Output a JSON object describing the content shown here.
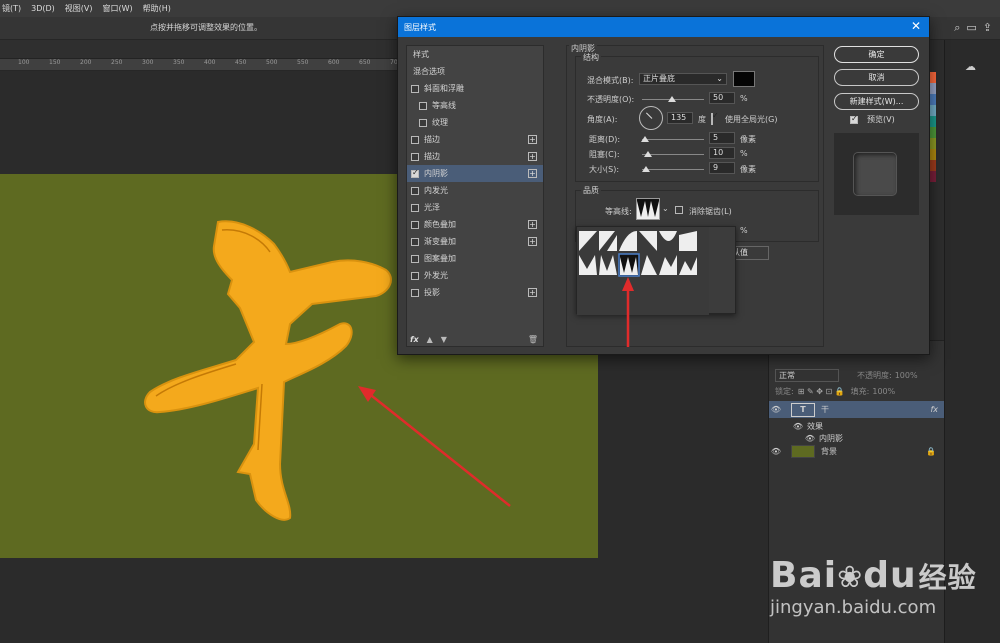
{
  "menubar": {
    "items": [
      "镜(T)",
      "3D(D)",
      "视图(V)",
      "窗口(W)",
      "帮助(H)"
    ]
  },
  "optionsbar": {
    "hint": "点按并拖移可调整效果的位置。"
  },
  "ruler": {
    "ticks": [
      "100",
      "150",
      "200",
      "250",
      "300",
      "350",
      "400",
      "450",
      "500",
      "550",
      "600",
      "650",
      "700"
    ]
  },
  "colors": {
    "canvas_bg": "#5e6a21",
    "glyph_fill": "#f4a91c",
    "glyph_stroke": "#d98a10",
    "accent_blue": "#0a73d9",
    "arrow_red": "#e02b2b"
  },
  "canvas": {
    "glyph": "干"
  },
  "dialog": {
    "title": "图层样式",
    "close_icon": "close-icon",
    "styles": [
      {
        "label": "样式",
        "type": "header"
      },
      {
        "label": "混合选项",
        "type": "header"
      },
      {
        "label": "斜面和浮雕",
        "checked": false,
        "plus": false
      },
      {
        "label": "等高线",
        "checked": false,
        "plus": false,
        "indent": true
      },
      {
        "label": "纹理",
        "checked": false,
        "plus": false,
        "indent": true
      },
      {
        "label": "描边",
        "checked": false,
        "plus": true
      },
      {
        "label": "描边",
        "checked": false,
        "plus": true
      },
      {
        "label": "内阴影",
        "checked": true,
        "plus": true,
        "selected": true
      },
      {
        "label": "内发光",
        "checked": false,
        "plus": false
      },
      {
        "label": "光泽",
        "checked": false,
        "plus": false
      },
      {
        "label": "颜色叠加",
        "checked": false,
        "plus": true
      },
      {
        "label": "渐变叠加",
        "checked": false,
        "plus": true
      },
      {
        "label": "图案叠加",
        "checked": false,
        "plus": false
      },
      {
        "label": "外发光",
        "checked": false,
        "plus": false
      },
      {
        "label": "投影",
        "checked": false,
        "plus": true
      }
    ],
    "footer_fx": "fx",
    "inner_shadow": {
      "section_title": "内阴影",
      "structure_title": "结构",
      "blend_mode_label": "混合模式(B):",
      "blend_mode_value": "正片叠底",
      "opacity_label": "不透明度(O):",
      "opacity_value": "50",
      "opacity_unit": "%",
      "angle_label": "角度(A):",
      "angle_value": "135",
      "angle_unit": "度",
      "global_light_label": "使用全局光(G)",
      "distance_label": "距离(D):",
      "distance_value": "5",
      "distance_unit": "像素",
      "choke_label": "阻塞(C):",
      "choke_value": "10",
      "choke_unit": "%",
      "size_label": "大小(S):",
      "size_value": "9",
      "size_unit": "像素",
      "quality_title": "品质",
      "contour_label": "等高线:",
      "anti_alias_label": "消除锯齿(L)",
      "noise_unit": "%",
      "reset_default_fragment": "认值"
    },
    "buttons": {
      "ok": "确定",
      "cancel": "取消",
      "new_style": "新建样式(W)...",
      "preview": "预览(V)"
    }
  },
  "layers": {
    "blend_mode": "正常",
    "opacity_label": "不透明度:",
    "opacity_value": "100%",
    "lock_label": "锁定:",
    "fill_label": "填充:",
    "fill_value": "100%",
    "items": [
      {
        "name": "干",
        "kind": "text",
        "fx": "fx",
        "selected": true
      },
      {
        "name": "效果",
        "kind": "effects"
      },
      {
        "name": "内阴影",
        "kind": "effect"
      },
      {
        "name": "背景",
        "kind": "background"
      }
    ]
  },
  "watermark": {
    "brand": "Bai",
    "paw": "du",
    "brand_cn": "经验",
    "url": "jingyan.baidu.com"
  }
}
